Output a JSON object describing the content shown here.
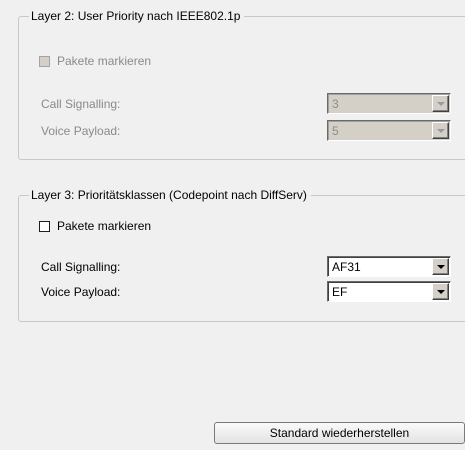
{
  "layer2": {
    "title": "Layer 2: User Priority nach IEEE802.1p",
    "mark_packets_label": "Pakete markieren",
    "call_signalling_label": "Call Signalling:",
    "call_signalling_value": "3",
    "voice_payload_label": "Voice Payload:",
    "voice_payload_value": "5"
  },
  "layer3": {
    "title": "Layer 3: Prioritätsklassen (Codepoint nach DiffServ)",
    "mark_packets_label": "Pakete markieren",
    "call_signalling_label": "Call Signalling:",
    "call_signalling_value": "AF31",
    "voice_payload_label": "Voice Payload:",
    "voice_payload_value": "EF"
  },
  "footer": {
    "reset_button_label": "Standard wiederherstellen"
  }
}
